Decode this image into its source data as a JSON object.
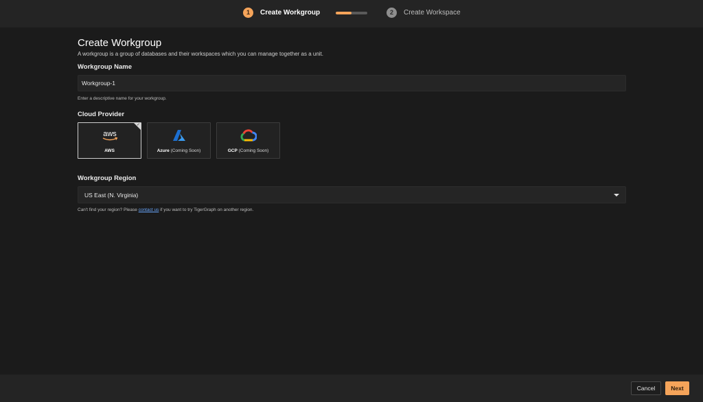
{
  "stepper": {
    "steps": [
      {
        "number": "1",
        "label": "Create Workgroup"
      },
      {
        "number": "2",
        "label": "Create Workspace"
      }
    ],
    "progress_percent": 50
  },
  "page": {
    "title": "Create Workgroup",
    "description": "A workgroup is a group of databases and their workspaces which you can manage together as a unit."
  },
  "workgroup_name": {
    "label": "Workgroup Name",
    "value": "Workgroup-1",
    "helper": "Enter a descriptive name for your workgroup."
  },
  "cloud_provider": {
    "label": "Cloud Provider",
    "options": [
      {
        "name": "AWS",
        "note": "",
        "logo_text": "aws",
        "selected": true
      },
      {
        "name": "Azure",
        "note": "(Coming Soon)",
        "selected": false
      },
      {
        "name": "GCP",
        "note": "(Coming Soon)",
        "selected": false
      }
    ]
  },
  "region": {
    "label": "Workgroup Region",
    "value": "US East (N. Virginia)",
    "helper_before": "Can't find your region? Please ",
    "helper_link": "contact us",
    "helper_after": " if you want to try TigerGraph on another region."
  },
  "footer": {
    "cancel_label": "Cancel",
    "next_label": "Next"
  },
  "colors": {
    "accent": "#f5a45a",
    "background": "#1b1b1b",
    "link": "#6aa8ff"
  }
}
